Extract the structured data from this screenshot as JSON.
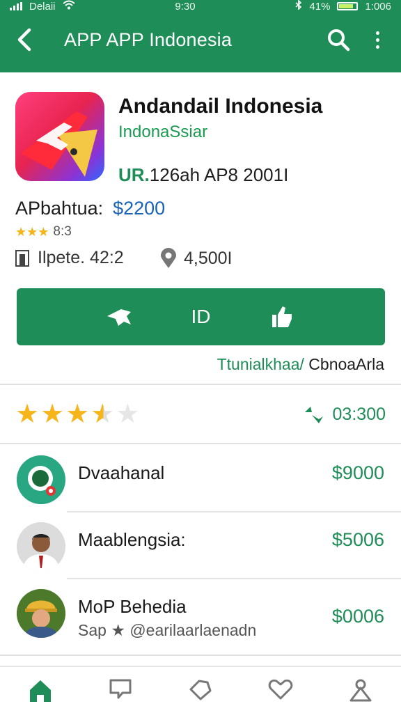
{
  "status_bar": {
    "carrier": "Delaii",
    "time": "9:30",
    "battery": "41%",
    "extra": "1:006"
  },
  "toolbar": {
    "title": "APP APP Indonesia"
  },
  "app": {
    "name": "Andandail Indonesia",
    "developer": "IndonaSsiar",
    "version_prefix": "UR.",
    "version_rest": "126ah AP8 2001I",
    "price_label": "APbahtua:",
    "price_value": "$2200",
    "small_stars": "★★★",
    "small_rating": "8:3",
    "update_text": "Ilpete. 42:2",
    "downloads": "4,500I"
  },
  "actions": {
    "middle_label": "ID"
  },
  "compat": {
    "green": "Ttunialkhaa/",
    "dark": " CbnoaArla"
  },
  "rating": {
    "stars_filled": 3.5,
    "stars_total": 5,
    "count": "03:300"
  },
  "list": [
    {
      "title": "Dvaahanal",
      "subtitle": "",
      "price": "$9000"
    },
    {
      "title": "Maablengsia:",
      "subtitle": "",
      "price": "$5006"
    },
    {
      "title": "MoP Behedia",
      "subtitle": "Sap ★ @earilaarlaenadn",
      "price": "$0006"
    }
  ],
  "colors": {
    "primary": "#1f8d57",
    "price_blue": "#1a62b8",
    "star": "#f6b51b"
  }
}
